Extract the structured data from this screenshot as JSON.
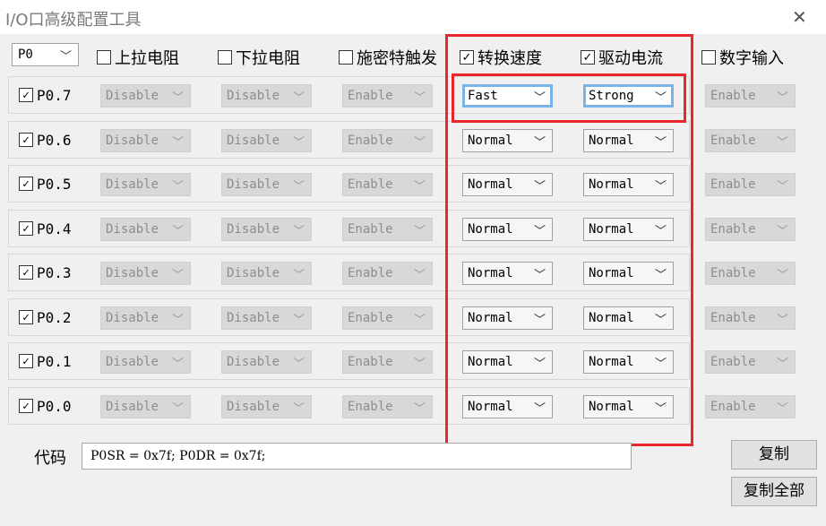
{
  "window": {
    "title": "I/O口高级配置工具",
    "close_icon": "close-icon"
  },
  "port_select": {
    "value": "P0"
  },
  "headers": [
    {
      "label": "上拉电阻",
      "checked": false
    },
    {
      "label": "下拉电阻",
      "checked": false
    },
    {
      "label": "施密特触发",
      "checked": false
    },
    {
      "label": "转换速度",
      "checked": true
    },
    {
      "label": "驱动电流",
      "checked": true
    },
    {
      "label": "数字输入",
      "checked": false
    }
  ],
  "rows": [
    {
      "label": "P0.7",
      "checked": true,
      "values": [
        "Disable",
        "Disable",
        "Enable",
        "Fast",
        "Strong",
        "Enable"
      ]
    },
    {
      "label": "P0.6",
      "checked": true,
      "values": [
        "Disable",
        "Disable",
        "Enable",
        "Normal",
        "Normal",
        "Enable"
      ]
    },
    {
      "label": "P0.5",
      "checked": true,
      "values": [
        "Disable",
        "Disable",
        "Enable",
        "Normal",
        "Normal",
        "Enable"
      ]
    },
    {
      "label": "P0.4",
      "checked": true,
      "values": [
        "Disable",
        "Disable",
        "Enable",
        "Normal",
        "Normal",
        "Enable"
      ]
    },
    {
      "label": "P0.3",
      "checked": true,
      "values": [
        "Disable",
        "Disable",
        "Enable",
        "Normal",
        "Normal",
        "Enable"
      ]
    },
    {
      "label": "P0.2",
      "checked": true,
      "values": [
        "Disable",
        "Disable",
        "Enable",
        "Normal",
        "Normal",
        "Enable"
      ]
    },
    {
      "label": "P0.1",
      "checked": true,
      "values": [
        "Disable",
        "Disable",
        "Enable",
        "Normal",
        "Normal",
        "Enable"
      ]
    },
    {
      "label": "P0.0",
      "checked": true,
      "values": [
        "Disable",
        "Disable",
        "Enable",
        "Normal",
        "Normal",
        "Enable"
      ]
    }
  ],
  "code": {
    "label": "代码",
    "value": "P0SR = 0x7f; P0DR = 0x7f;"
  },
  "buttons": {
    "copy": "复制",
    "copy_all": "复制全部"
  },
  "colors": {
    "highlight_red": "#e8262c",
    "focus_blue": "#79b4e8"
  }
}
